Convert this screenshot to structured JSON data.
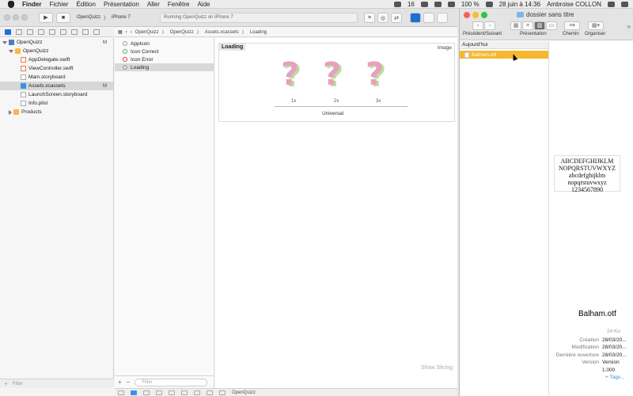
{
  "menubar": {
    "app": "Finder",
    "items": [
      "Fichier",
      "Édition",
      "Présentation",
      "Aller",
      "Fenêtre",
      "Aide"
    ],
    "battery": "100 %",
    "notifications": "16",
    "datetime": "28 juin à 14:36",
    "user": "Ambroise COLLON"
  },
  "xcode": {
    "scheme": "OpenQuizz",
    "device": "iPhone 7",
    "status": "Running OpenQuizz on iPhone 7",
    "navigator": [
      {
        "label": "OpenQuizz",
        "badge": "M",
        "level": 0,
        "type": "proj"
      },
      {
        "label": "OpenQuizz",
        "badge": "",
        "level": 1,
        "type": "folder"
      },
      {
        "label": "AppDelegate.swift",
        "badge": "",
        "level": 2,
        "type": "swift"
      },
      {
        "label": "ViewController.swift",
        "badge": "",
        "level": 2,
        "type": "swift"
      },
      {
        "label": "Main.storyboard",
        "badge": "",
        "level": 2,
        "type": "file"
      },
      {
        "label": "Assets.xcassets",
        "badge": "M",
        "level": 2,
        "type": "assets"
      },
      {
        "label": "LaunchScreen.storyboard",
        "badge": "",
        "level": 2,
        "type": "file"
      },
      {
        "label": "Info.plist",
        "badge": "",
        "level": 2,
        "type": "file"
      },
      {
        "label": "Products",
        "badge": "",
        "level": 1,
        "type": "folder"
      }
    ],
    "nav_filter": "Filter",
    "breadcrumb": [
      "OpenQuizz",
      "OpenQuizz",
      "Assets.xcassets",
      "Loading"
    ],
    "sets": [
      "AppIcon",
      "Icon Correct",
      "Icon Error",
      "Loading"
    ],
    "sets_filter": "Filter",
    "editor": {
      "name": "Loading",
      "kind": "Image",
      "scales": [
        "1x",
        "2x",
        "3x"
      ],
      "glyph": "?",
      "universal": "Universal",
      "show_slicing": "Show Slicing"
    },
    "debug_target": "OpenQuizz"
  },
  "finder": {
    "title": "dossier sans titre",
    "labels": {
      "back": "Précédent/Suivant",
      "view": "Présentation",
      "path": "Chemin",
      "arrange": "Organiser"
    },
    "section": "Aujourd'hui",
    "file": "Balham.otf",
    "preview_lines": [
      "ABCDEFGHIJKLM",
      "NOPQRSTUVWXYZ",
      "abcdefghijklm",
      "nopqrstuvwxyz",
      "1234567890"
    ],
    "size": "24 Ko",
    "meta": [
      {
        "k": "Création",
        "v": "28/03/20..."
      },
      {
        "k": "Modification",
        "v": "28/03/20..."
      },
      {
        "k": "Dernière ouverture",
        "v": "28/03/20..."
      },
      {
        "k": "Version",
        "v": "Version"
      },
      {
        "k": "",
        "v": "1.000"
      }
    ],
    "tags": "+ Tags..."
  },
  "colors": {
    "selection": "#f5b82e",
    "accent": "#3d8fe3"
  }
}
